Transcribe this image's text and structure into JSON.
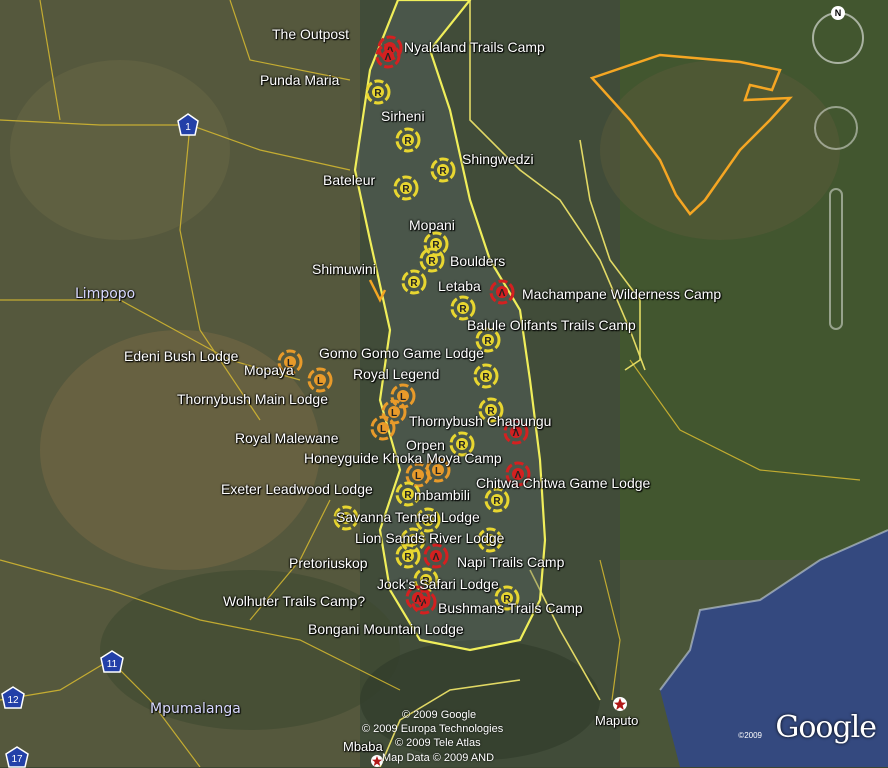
{
  "regions": {
    "limpopo": "Limpopo",
    "mpumalanga": "Mpumalanga"
  },
  "highway_shields": [
    "1",
    "11",
    "12",
    "17"
  ],
  "cities": {
    "maputo": "Maputo",
    "mbabane": "Mbaba"
  },
  "places": [
    "The Outpost",
    "Nyalaland Trails Camp",
    "Punda Maria",
    "Sirheni",
    "Shingwedzi",
    "Bateleur",
    "Mopani",
    "Boulders",
    "Shimuwini",
    "Letaba",
    "Machampane Wilderness Camp",
    "Balule Olifants Trails Camp",
    "Edeni Bush Lodge",
    "Gomo Gomo Game Lodge",
    "Mopaya",
    "Royal Legend",
    "Thornybush Main Lodge",
    "Thornybush Chapungu",
    "Royal Malewane",
    "Orpen",
    "Honeyguide Khoka Moya Camp",
    "Chitwa Chitwa Game Lodge",
    "Exeter Leadwood Lodge",
    "mbambili",
    "Savanna Tented Lodge",
    "Lion Sands River Lodge",
    "Pretoriuskop",
    "Napi Trails Camp",
    "Jock's Safari Lodge",
    "Wolhuter Trails Camp?",
    "Bushmans Trails Camp",
    "Bongani Mountain Lodge"
  ],
  "marker_letters": {
    "rest_camp": "R",
    "lodge": "L",
    "trail": "Λ"
  },
  "attribution": [
    "© 2009 Google",
    "© 2009 Europa Technologies",
    "© 2009 Tele Atlas",
    "Map Data © 2009 AND"
  ],
  "logo": {
    "text": "Google",
    "year": "©2009"
  },
  "compass": {
    "north": "N"
  },
  "colors": {
    "park_boundary": "#f0ee5a",
    "limpopo_park_outline": "#f5a623",
    "rest_camp_marker": "#e8d630",
    "lodge_marker": "#e89a2a",
    "trail_marker": "#d42020",
    "road": "#e0c030",
    "sea": "#3a4e8c"
  }
}
